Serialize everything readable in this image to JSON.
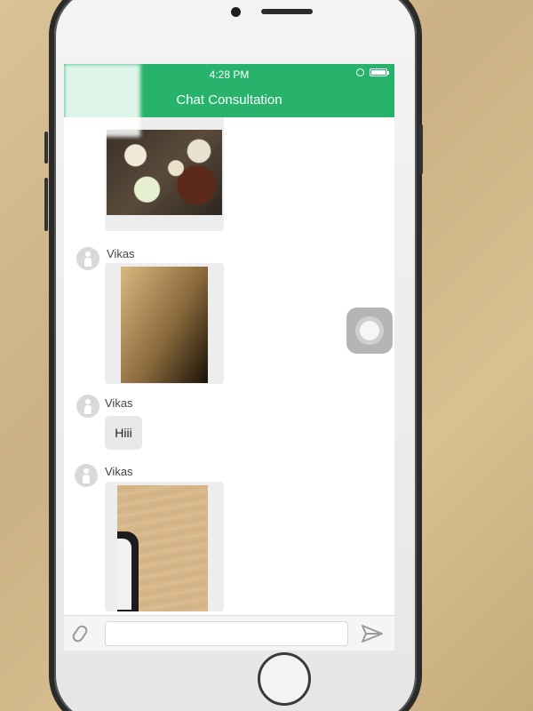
{
  "status_bar": {
    "time": "4:28 PM"
  },
  "header": {
    "title": "Chat Consultation"
  },
  "messages": [
    {
      "type": "image",
      "subject": "food platters"
    },
    {
      "type": "image",
      "sender": "Vikas",
      "subject": "wood surface"
    },
    {
      "type": "text",
      "sender": "Vikas",
      "text": "Hiii"
    },
    {
      "type": "image",
      "sender": "Vikas",
      "subject": "phone on wood table"
    }
  ],
  "composer": {
    "message_value": "",
    "placeholder": ""
  },
  "icons": {
    "attach": "paperclip-icon",
    "send": "send-icon",
    "avatar": "person-icon",
    "assistive": "assistive-touch-icon"
  },
  "colors": {
    "header": "#27b36b",
    "bubble": "#e8e8e8"
  }
}
